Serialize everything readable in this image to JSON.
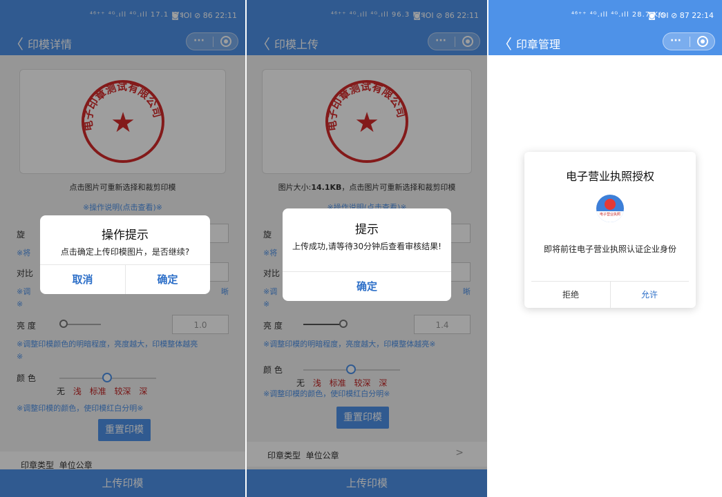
{
  "status": {
    "p1": {
      "left": "⁴⁶⁺⁺ ⁴ᴳ.ıll ⁴ᴳ.ıll 17.1 K/s",
      "right": "◙ ⅠOⅠ ⊘ 86 22:11"
    },
    "p2": {
      "left": "⁴⁶⁺⁺ ⁴ᴳ.ıll ⁴ᴳ.ıll 96.3 K/s",
      "right": "◙ ⅠOⅠ ⊘ 86 22:11"
    },
    "p3": {
      "left": "⁴⁶⁺⁺ ⁴ᴳ.ıll ⁴ᴳ.ıll 28.7 K/s",
      "right": "◙ ⅠOⅠ ⊘ 87 22:14"
    }
  },
  "nav": {
    "back": "〈",
    "more": "···",
    "p1_title": "印模详情",
    "p2_title": "印模上传",
    "p3_title": "印章管理"
  },
  "seal": {
    "top_text": "电子印章测试有限公司",
    "star": "★",
    "color": "#d42a2a"
  },
  "p1": {
    "hint": "点击图片可重新选择和裁剪印模",
    "op": "※操作说明(点击查看)※",
    "rotate_label": "旋",
    "rotate_note": "※将",
    "contrast_label": "对比",
    "contrast_note": "※调",
    "contrast_note_tail": "晰",
    "contrast_note2": "※",
    "brightness_label": "亮  度",
    "brightness_value": "1.0",
    "brightness_level": 0.0,
    "brightness_note": "※调整印模颜色的明暗程度，亮度越大，印模整体越亮",
    "brightness_note2": "※",
    "color_label": "颜  色",
    "color_options": [
      "无",
      "浅",
      "标准",
      "较深",
      "深"
    ],
    "color_selected": "标准",
    "color_note": "※调整印模的颜色，使印模红白分明※",
    "reset": "重置印模",
    "type_label": "印章类型",
    "type_value": "单位公章",
    "upload": "上传印模",
    "dialog": {
      "title": "操作提示",
      "message": "点击确定上传印模图片，是否继续?",
      "cancel": "取消",
      "confirm": "确定"
    }
  },
  "p2": {
    "hint_prefix": "图片大小:",
    "hint_size": "14.1KB",
    "hint_suffix": "，点击图片可重新选择和裁剪印模",
    "op": "※操作说明(点击查看)※",
    "rotate_label": "旋",
    "rotate_note": "※将",
    "contrast_label": "对比",
    "contrast_note": "※调",
    "contrast_note_tail": "晰",
    "contrast_note2": "※",
    "brightness_label": "亮  度",
    "brightness_value": "1.4",
    "brightness_level": 0.4,
    "brightness_note": "※调整印模的明暗程度，亮度越大，印模整体越亮※",
    "color_label": "颜  色",
    "color_options": [
      "无",
      "浅",
      "标准",
      "较深",
      "深"
    ],
    "color_selected": "标准",
    "color_note": "※调整印模的颜色，使印模红白分明※",
    "reset": "重置印模",
    "type_label": "印章类型",
    "type_value": "单位公章",
    "chevron": ">",
    "upload": "上传印模",
    "dialog": {
      "title": "提示",
      "message": "上传成功,请等待30分钟后查看审核结果!",
      "confirm": "确定"
    }
  },
  "p3": {
    "title": "电子营业执照授权",
    "logo_caption": "电子营业执照",
    "message": "即将前往电子营业执照认证企业身份",
    "reject": "拒绝",
    "allow": "允许"
  }
}
